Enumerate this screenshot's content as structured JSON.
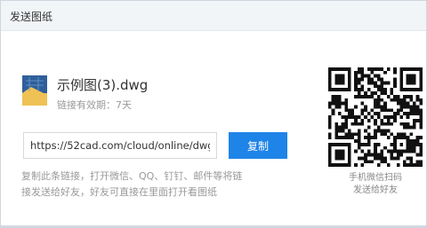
{
  "dialog": {
    "title": "发送图纸"
  },
  "file": {
    "icon": "dwg-file-icon",
    "name": "示例图(3).dwg",
    "expiry": "链接有效期：7天"
  },
  "share": {
    "link_value": "https://52cad.com/cloud/online/dwgsee?s...",
    "copy_label": "复制",
    "hint_line1": "复制此条链接，打开微信、QQ、钉钉、邮件等将链",
    "hint_line2": "接发送给好友，好友可直接在里面打开看图纸"
  },
  "qr": {
    "caption_line1": "手机微信扫码",
    "caption_line2": "发送给好友"
  },
  "colors": {
    "accent": "#1f84e8",
    "titlebar_bg": "#f2f5f8",
    "muted_text": "#999999"
  }
}
